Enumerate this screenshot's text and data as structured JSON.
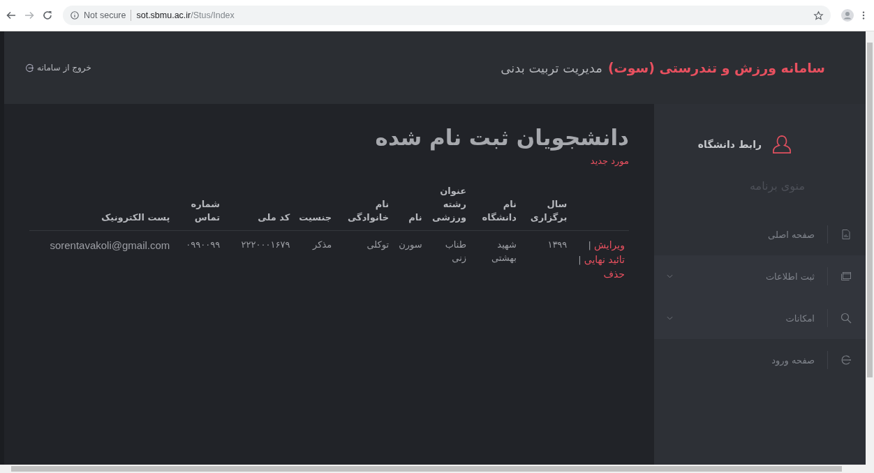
{
  "browser": {
    "security": "Not secure",
    "url_host": "sot.sbmu.ac.ir",
    "url_path": "/Stus/Index"
  },
  "header": {
    "brand": "سامانه ورزش و تندرستی (سوت)",
    "subtitle": "مدیریت تربیت بدنی",
    "logout": "خروج از سامانه"
  },
  "sidebar": {
    "user": "رابط دانشگاه",
    "menu_title": "منوی برنامه",
    "items": [
      {
        "label": "صفحه اصلی",
        "kind": "report",
        "has_submenu": false
      },
      {
        "label": "ثبت اطلاعات",
        "kind": "window",
        "has_submenu": true
      },
      {
        "label": "امکانات",
        "kind": "search",
        "has_submenu": true
      },
      {
        "label": "صفحه ورود",
        "kind": "login",
        "has_submenu": false
      }
    ]
  },
  "main": {
    "title": "دانشجویان ثبت نام شده",
    "new_link": "مورد جدید",
    "table": {
      "columns": [
        "",
        "سال برگزاری",
        "نام دانشگاه",
        "عنوان رشته ورزشی",
        "نام",
        "نام خانوادگی",
        "جنسیت",
        "کد ملی",
        "شماره تماس",
        "پست الکترونیک"
      ],
      "rows": [
        {
          "cells": [
            {
              "links": [
                "ویرایش",
                "تائید نهایی",
                "حذف"
              ],
              "separator": "|"
            },
            "۱۳۹۹",
            "شهید بهشتی",
            "طناب زنی",
            "سورن",
            "توکلی",
            "مذکر",
            "۲۲۲۰۰۰۱۶۷۹",
            "۰۹۹۰۰۹۹",
            "sorentavakoli@gmail.com"
          ]
        }
      ]
    }
  }
}
